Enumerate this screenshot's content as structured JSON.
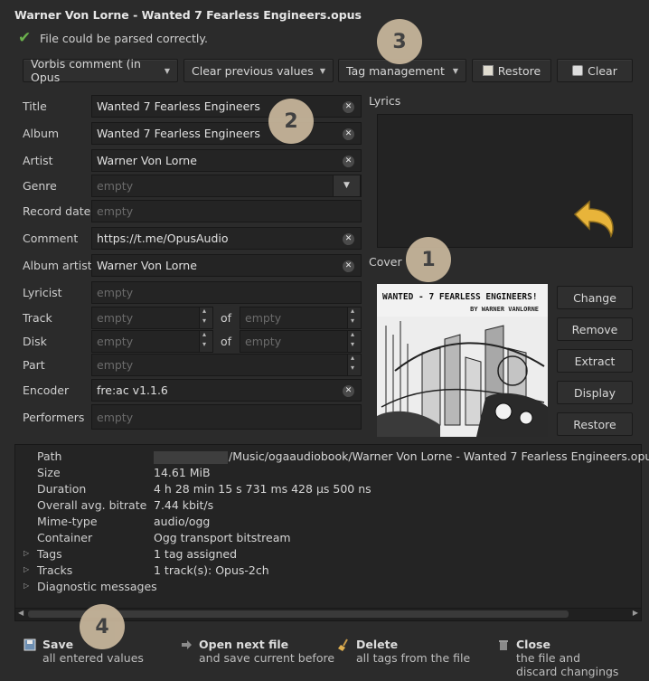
{
  "window": {
    "title": "Warner Von Lorne - Wanted 7 Fearless Engineers.opus"
  },
  "status": {
    "text": "File could be parsed correctly."
  },
  "toolbar": {
    "tag_format": "Vorbis comment (in Opus",
    "clear_previous": "Clear previous values",
    "tag_management": "Tag management",
    "restore": "Restore",
    "clear": "Clear"
  },
  "fields": {
    "title": {
      "label": "Title",
      "value": "Wanted 7 Fearless Engineers"
    },
    "album": {
      "label": "Album",
      "value": "Wanted 7 Fearless Engineers"
    },
    "artist": {
      "label": "Artist",
      "value": "Warner Von Lorne"
    },
    "genre": {
      "label": "Genre",
      "placeholder": "empty"
    },
    "record_date": {
      "label": "Record date",
      "placeholder": "empty"
    },
    "comment": {
      "label": "Comment",
      "value": "https://t.me/OpusAudio"
    },
    "album_artist": {
      "label": "Album artist",
      "value": "Warner Von Lorne"
    },
    "lyricist": {
      "label": "Lyricist",
      "placeholder": "empty"
    },
    "track": {
      "label": "Track",
      "placeholder": "empty",
      "of": "of",
      "total_placeholder": "empty"
    },
    "disk": {
      "label": "Disk",
      "placeholder": "empty",
      "of": "of",
      "total_placeholder": "empty"
    },
    "part": {
      "label": "Part",
      "placeholder": "empty"
    },
    "encoder": {
      "label": "Encoder",
      "value": "fre:ac v1.1.6"
    },
    "performers": {
      "label": "Performers",
      "placeholder": "empty"
    }
  },
  "lyrics": {
    "label": "Lyrics"
  },
  "cover": {
    "label": "Cover",
    "art_title": "WANTED - 7 FEARLESS ENGINEERS!",
    "art_byline": "BY WARNER VANLORNE",
    "buttons": [
      "Change",
      "Remove",
      "Extract",
      "Display",
      "Restore"
    ]
  },
  "info": {
    "rows": [
      {
        "key": "Path",
        "value": "/Music/ogaaudiobook/Warner Von Lorne - Wanted 7 Fearless Engineers.opus",
        "expandable": false
      },
      {
        "key": "Size",
        "value": "14.61 MiB",
        "expandable": false
      },
      {
        "key": "Duration",
        "value": "4 h 28 min 15 s 731 ms 428 µs 500 ns",
        "expandable": false
      },
      {
        "key": "Overall avg. bitrate",
        "value": "7.44 kbit/s",
        "expandable": false
      },
      {
        "key": "Mime-type",
        "value": "audio/ogg",
        "expandable": false
      },
      {
        "key": "Container",
        "value": "Ogg transport bitstream",
        "expandable": false
      },
      {
        "key": "Tags",
        "value": "1 tag assigned",
        "expandable": true
      },
      {
        "key": "Tracks",
        "value": "1 track(s): Opus-2ch",
        "expandable": true
      },
      {
        "key": "Diagnostic messages",
        "value": "",
        "expandable": true
      }
    ]
  },
  "actions": {
    "save": {
      "title": "Save",
      "sub": "all entered values"
    },
    "open_next": {
      "title": "Open next file",
      "sub": "and save current before"
    },
    "delete": {
      "title": "Delete",
      "sub": "all tags from the file"
    },
    "close": {
      "title": "Close",
      "sub": "the file and discard changings"
    }
  },
  "badges": [
    "1",
    "2",
    "3",
    "4"
  ],
  "colors": {
    "background": "#2b2b2b",
    "field_bg": "#242424",
    "badge": "#c9b79c",
    "check": "#6ab04c",
    "undo_arrow": "#e8b43a"
  }
}
